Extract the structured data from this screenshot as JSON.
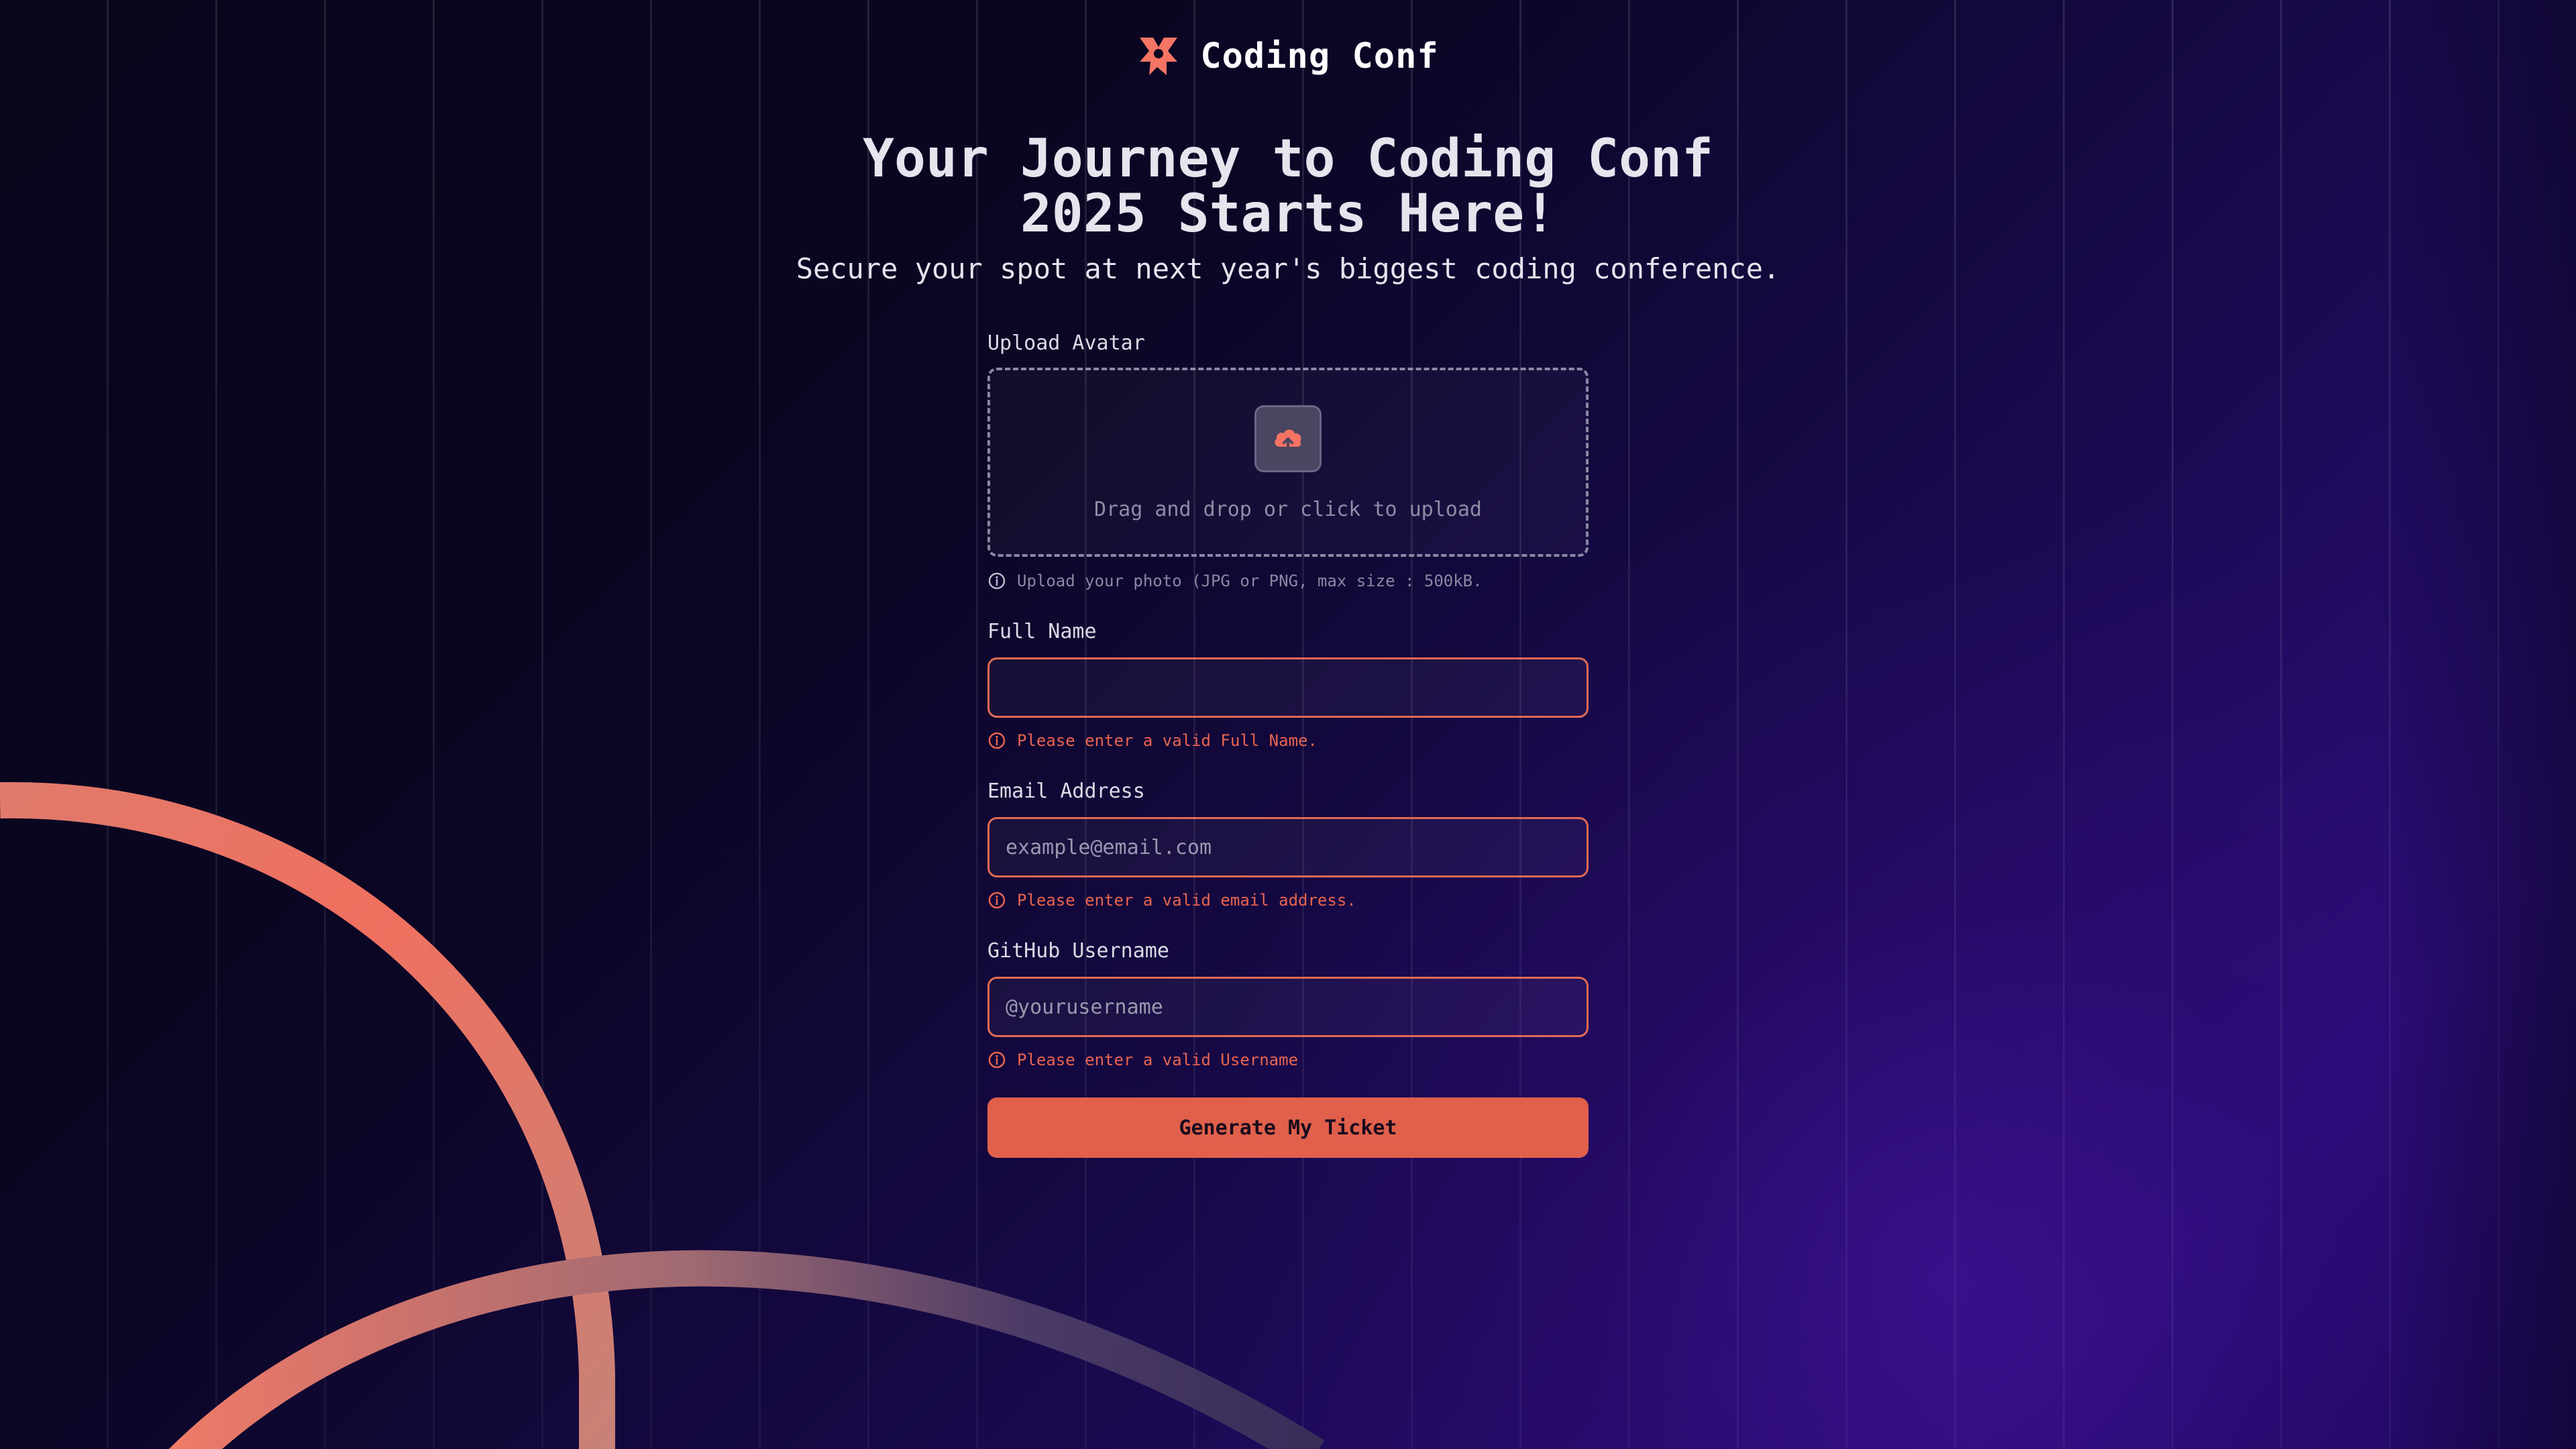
{
  "brand": {
    "logo_icon": "coding-conf-logo-icon",
    "name": "Coding Conf",
    "accent_color": "#F57463"
  },
  "header": {
    "title_line1": "Your Journey to Coding Conf",
    "title_line2": "2025 Starts Here!",
    "subtitle": "Secure your spot at next year's biggest coding conference."
  },
  "form": {
    "avatar": {
      "label": "Upload Avatar",
      "icon": "upload-cloud-icon",
      "dropzone_text": "Drag and drop or click to upload",
      "hint_icon": "info-icon",
      "hint": "Upload your photo (JPG or PNG, max size : 500kB."
    },
    "full_name": {
      "label": "Full Name",
      "value": "",
      "placeholder": "",
      "error": "Please enter a valid Full Name."
    },
    "email": {
      "label": "Email Address",
      "value": "",
      "placeholder": "example@email.com",
      "error": "Please enter a valid email address."
    },
    "github": {
      "label": "GitHub Username",
      "value": "",
      "placeholder": "@yourusername",
      "error": "Please enter a valid Username"
    },
    "submit_label": "Generate My Ticket"
  },
  "colors": {
    "background_dark": "#0B0620",
    "background_purple": "#2B0D7A",
    "error": "#E8644F",
    "button": "#E0604B"
  }
}
